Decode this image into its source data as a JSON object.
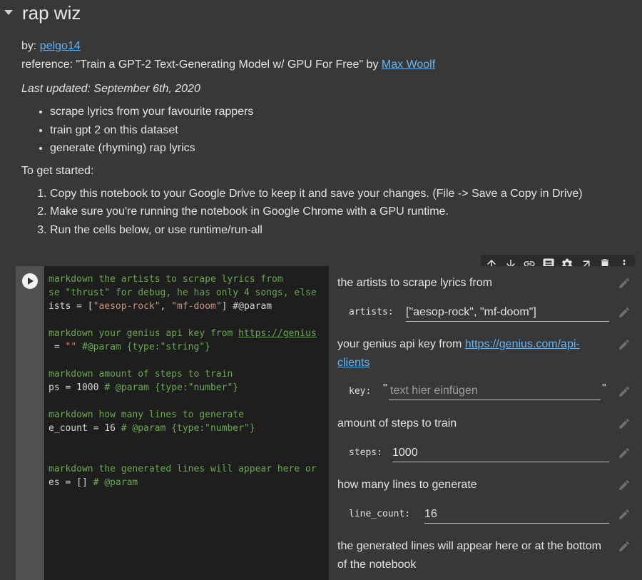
{
  "section": {
    "title": "rap wiz"
  },
  "markdown": {
    "by_prefix": "by: ",
    "author": "pelgo14",
    "reference_prefix": "reference: \"Train a GPT-2 Text-Generating Model w/ GPU For Free\" by ",
    "reference_author": "Max Woolf",
    "last_updated": "Last updated: September 6th, 2020",
    "bullets": [
      "scrape lyrics from your favourite rappers",
      "train gpt 2 on this dataset",
      "generate (rhyming) rap lyrics"
    ],
    "getting_started": "To get started:",
    "steps": [
      "Copy this notebook to your Google Drive to keep it and save your changes. (File -> Save a Copy in Drive)",
      "Make sure you're running the notebook in Google Chrome with a GPU runtime.",
      "Run the cells below, or use runtime/run-all"
    ]
  },
  "toolbar": {
    "icons": [
      "arrow-up-icon",
      "arrow-down-icon",
      "link-icon",
      "comment-icon",
      "gear-icon",
      "open-in-new-icon",
      "delete-icon",
      "more-vert-icon"
    ]
  },
  "code": {
    "l1": "markdown the artists to scrape lyrics from",
    "l2": "se \"thrust\" for debug, he has only 4 songs, else",
    "l3a": "ists = [",
    "l3b": "\"aesop-rock\"",
    "l3c": ", ",
    "l3d": "\"mf-doom\"",
    "l3e": "] #@param",
    "l4a": "markdown your genius api key from ",
    "l4b": "https://genius",
    "l5a": " = ",
    "l5b": "\"\"",
    "l5c": " #@param {type:\"string\"}",
    "l6": "markdown amount of steps to train",
    "l7a": "ps = 1000 ",
    "l7b": "# @param {type:\"number\"}",
    "l8": "markdown how many lines to generate",
    "l9a": "e_count = 16 ",
    "l9b": "# @param {type:\"number\"}",
    "l10": "markdown the generated lines will appear here or",
    "l11a": "es = [] ",
    "l11b": "# @param"
  },
  "form": {
    "artists_desc": "the artists to scrape lyrics from",
    "artists_label": "artists:",
    "artists_value": "[\"aesop-rock\", \"mf-doom\"]",
    "key_desc": "your genius api key from ",
    "key_link_1": "https://genius.com/api-",
    "key_link_2": "clients",
    "key_label": "key:",
    "key_quote_open": "\"",
    "key_placeholder": "text hier einfügen",
    "key_quote_close": "\"",
    "steps_desc": "amount of steps to train",
    "steps_label": "steps:",
    "steps_value": "1000",
    "lines_desc": "how many lines to generate",
    "line_count_label": "line_count:",
    "line_count_value": "16",
    "generated_desc_1": "the generated lines will appear here or at the bottom",
    "generated_desc_2": "of the notebook"
  }
}
